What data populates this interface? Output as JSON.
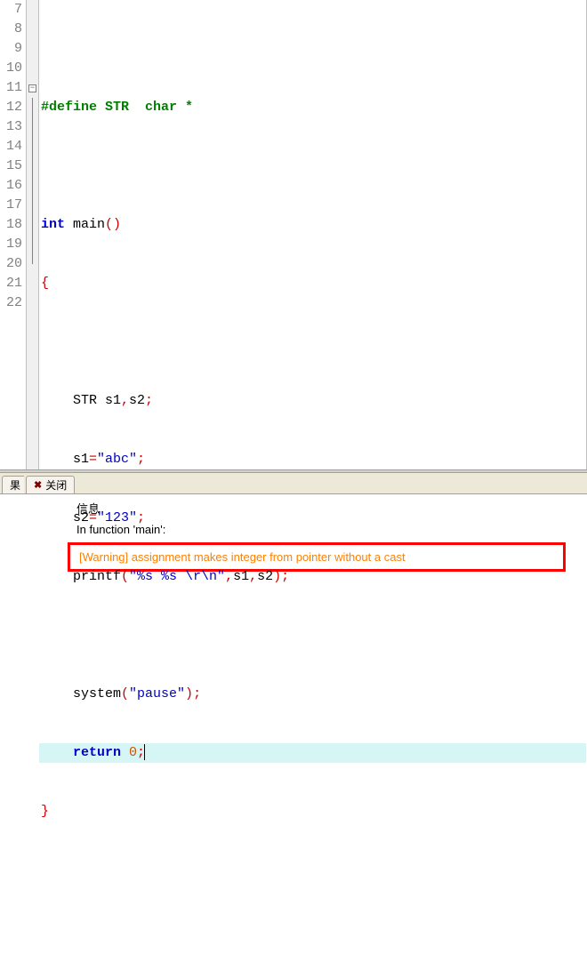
{
  "code": {
    "lines": [
      7,
      8,
      9,
      10,
      11,
      12,
      13,
      14,
      15,
      16,
      17,
      18,
      19,
      20,
      21,
      22
    ],
    "line8_directive": "#define",
    "line8_macro": " STR  ",
    "line8_type": "char",
    "line8_rest": " *",
    "line10_kw": "int",
    "line10_name": " main",
    "line10_paren_open": "(",
    "line10_paren_close": ")",
    "line11_brace": "{",
    "line13_text": "    STR s1",
    "line13_comma": ",",
    "line13_text2": "s2",
    "line13_semi": ";",
    "line14_lhs": "    s1",
    "line14_eq": "=",
    "line14_str": "\"abc\"",
    "line14_semi": ";",
    "line15_lhs": "    s2",
    "line15_eq": "=",
    "line15_str": "\"123\"",
    "line15_semi": ";",
    "line16_fn": "    printf",
    "line16_po": "(",
    "line16_str": "\"%s %s \\r\\n\"",
    "line16_c1": ",",
    "line16_a1": "s1",
    "line16_c2": ",",
    "line16_a2": "s2",
    "line16_pc": ")",
    "line16_semi": ";",
    "line18_fn": "    system",
    "line18_po": "(",
    "line18_str": "\"pause\"",
    "line18_pc": ")",
    "line18_semi": ";",
    "line19_kw": "    return",
    "line19_sp": " ",
    "line19_num": "0",
    "line19_semi": ";",
    "line20_brace": "}"
  },
  "fold_marker": "−",
  "tabs": {
    "tab1_partial": "果",
    "tab2_label": "关闭",
    "close_glyph": "✖"
  },
  "output": {
    "header": "信息",
    "row1": "In function 'main':",
    "warning": "[Warning] assignment makes integer from pointer without a cast"
  }
}
